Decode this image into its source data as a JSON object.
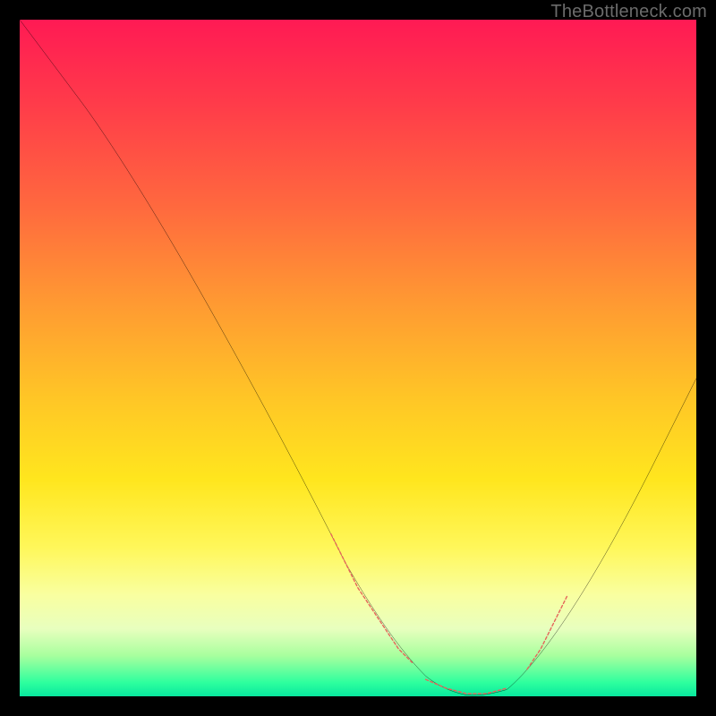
{
  "watermark": "TheBottleneck.com",
  "chart_data": {
    "type": "line",
    "title": "",
    "xlabel": "",
    "ylabel": "",
    "xlim": [
      0,
      100
    ],
    "ylim": [
      0,
      100
    ],
    "grid": false,
    "legend": false,
    "background_gradient": {
      "direction": "top-to-bottom",
      "stops": [
        {
          "pos": 0,
          "color": "#ff1a54"
        },
        {
          "pos": 28,
          "color": "#ff6a3e"
        },
        {
          "pos": 56,
          "color": "#ffc626"
        },
        {
          "pos": 78,
          "color": "#fff75a"
        },
        {
          "pos": 90,
          "color": "#e8ffbe"
        },
        {
          "pos": 100,
          "color": "#08e89e"
        }
      ]
    },
    "series": [
      {
        "name": "bottleneck-curve",
        "stroke": "#000000",
        "x": [
          0,
          3,
          6,
          9,
          12,
          18,
          26,
          34,
          42,
          48,
          52,
          56,
          60,
          64,
          68,
          72,
          78,
          86,
          94,
          100
        ],
        "y": [
          100,
          96,
          92,
          88,
          84,
          75,
          61,
          47,
          32,
          20,
          13,
          7,
          3,
          1,
          0,
          1,
          6,
          19,
          35,
          47
        ]
      },
      {
        "name": "highlight-dashes-left",
        "stroke": "#e4665b",
        "style": "dashed",
        "x": [
          46,
          48,
          50,
          52,
          54,
          56,
          58
        ],
        "y": [
          24,
          20,
          16,
          13,
          10,
          7,
          5
        ]
      },
      {
        "name": "highlight-dashes-bottom",
        "stroke": "#e4665b",
        "style": "dashed",
        "x": [
          60,
          63,
          66,
          69,
          72
        ],
        "y": [
          2,
          1,
          0,
          0,
          1
        ]
      },
      {
        "name": "highlight-dashes-right",
        "stroke": "#e4665b",
        "style": "dashed",
        "x": [
          75,
          77,
          79,
          81
        ],
        "y": [
          4,
          7,
          11,
          15
        ]
      }
    ]
  }
}
